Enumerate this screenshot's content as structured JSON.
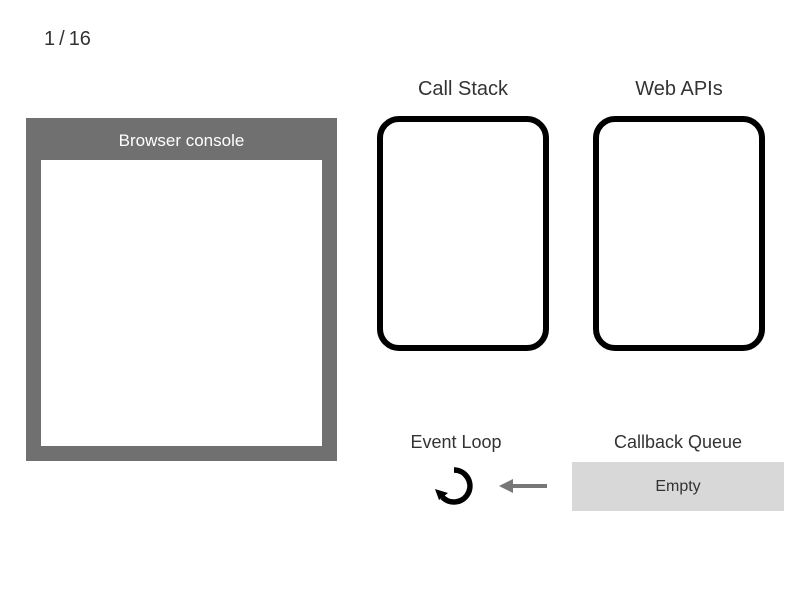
{
  "page_counter": {
    "current": "1",
    "sep": "/",
    "total": "16"
  },
  "console": {
    "title": "Browser console"
  },
  "call_stack": {
    "title": "Call Stack"
  },
  "web_apis": {
    "title": "Web APIs"
  },
  "event_loop": {
    "title": "Event Loop"
  },
  "callback_queue": {
    "title": "Callback Queue",
    "status": "Empty"
  }
}
